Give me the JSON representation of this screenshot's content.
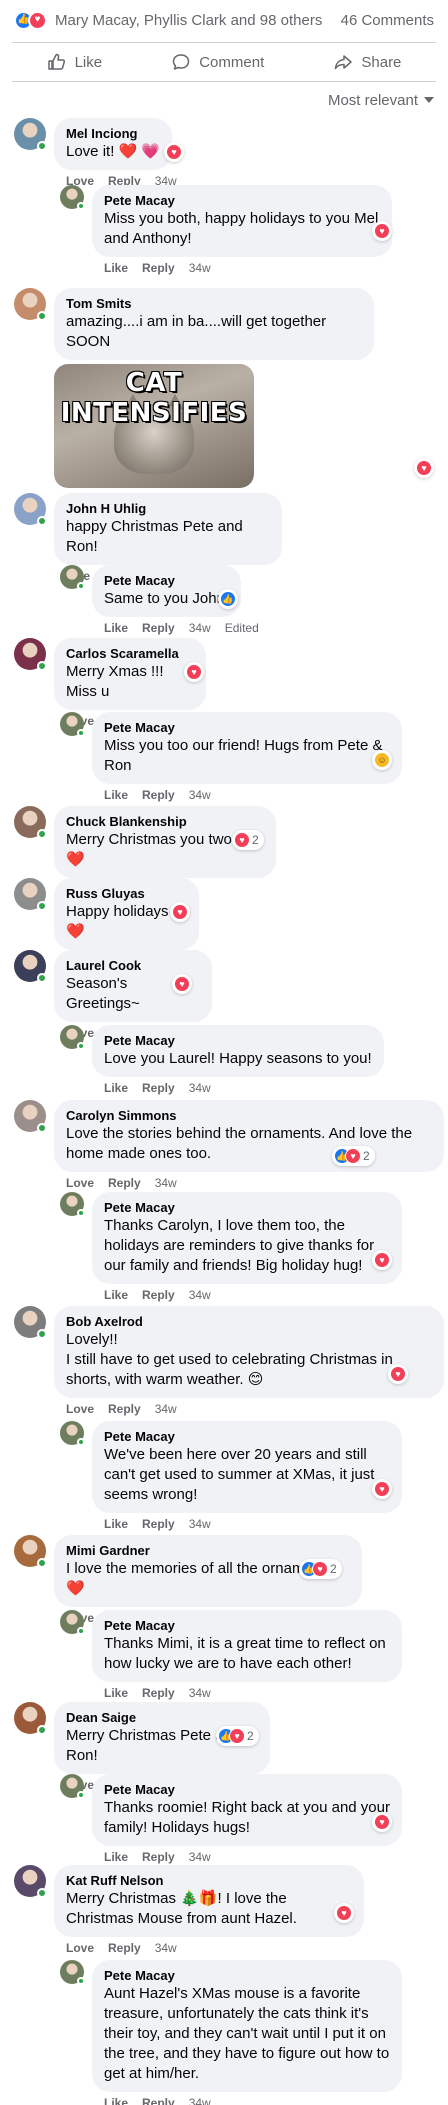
{
  "summary": {
    "names": "Mary Macay, Phyllis Clark and 98 others",
    "comments": "46 Comments",
    "like_glyph": "👍",
    "love_glyph": "♥"
  },
  "actions": {
    "like": "Like",
    "comment": "Comment",
    "share": "Share"
  },
  "sort": {
    "label": "Most relevant"
  },
  "meta_labels": {
    "love": "Love",
    "like": "Like",
    "reply": "Reply",
    "edited": "Edited"
  },
  "colors": {
    "like": "#1877f2",
    "love": "#f33e58",
    "bubble": "#f0f2f5",
    "meta": "#65676b"
  },
  "comments": [
    {
      "author": "Mel Inciong",
      "text": "Love it! ❤️ 💗",
      "time": "34w",
      "reaction": "love"
    },
    {
      "author": "Pete Macay",
      "text": "Miss you both, happy holidays to you Mel and Anthony!",
      "time": "34w",
      "reaction": "love"
    },
    {
      "author": "Tom Smits",
      "text": "amazing....i am in ba....will get together SOON",
      "time": "34w",
      "reaction": "love",
      "gif_text": "CAT INTENSIFIES"
    },
    {
      "author": "John H Uhlig",
      "text": "happy Christmas Pete and Ron!",
      "time": "34w"
    },
    {
      "author": "Pete Macay",
      "text": "Same to you John!",
      "time": "34w",
      "edited": "Edited",
      "reaction": "like"
    },
    {
      "author": "Carlos Scaramella",
      "text": "Merry Xmas !!! Miss u",
      "time": "34w",
      "reaction": "love"
    },
    {
      "author": "Pete Macay",
      "text": "Miss you too our friend! Hugs from Pete & Ron",
      "time": "34w",
      "reaction": "care"
    },
    {
      "author": "Chuck Blankenship",
      "text": "Merry Christmas you two ❤️ ❤️",
      "time": "34w",
      "reaction": "love",
      "reaction_count": "2"
    },
    {
      "author": "Russ Gluyas",
      "text": "Happy holidays ❤️",
      "time": "34w",
      "reaction": "love"
    },
    {
      "author": "Laurel Cook",
      "text": "Season's Greetings~",
      "time": "34w",
      "reaction": "love"
    },
    {
      "author": "Pete Macay",
      "text": "Love you Laurel! Happy seasons to you!",
      "time": "34w"
    },
    {
      "author": "Carolyn Simmons",
      "text": "Love the stories behind the ornaments. And love the home made ones too.",
      "time": "34w",
      "reaction": "like-love",
      "reaction_count": "2"
    },
    {
      "author": "Pete Macay",
      "text": "Thanks Carolyn, I love them too, the holidays are reminders to give thanks for our family and friends! Big holiday hug!",
      "time": "34w",
      "reaction": "love"
    },
    {
      "author": "Bob Axelrod",
      "text": "Lovely!!\nI still have to get used to celebrating Christmas in shorts, with warm weather. 😊",
      "time": "34w",
      "reaction": "love"
    },
    {
      "author": "Pete Macay",
      "text": "We've been here over 20 years and still can't get used to summer at XMas, it just seems wrong!",
      "time": "34w",
      "reaction": "love"
    },
    {
      "author": "Mimi Gardner",
      "text": "I love the memories of all the ornaments. ❤️",
      "time": "34w",
      "reaction": "like-love",
      "reaction_count": "2"
    },
    {
      "author": "Pete Macay",
      "text": "Thanks Mimi, it is a great time to reflect on how lucky we are to have each other!",
      "time": "34w"
    },
    {
      "author": "Dean Saige",
      "text": "Merry Christmas Pete and Ron!",
      "time": "34w",
      "reaction": "like-love",
      "reaction_count": "2"
    },
    {
      "author": "Pete Macay",
      "text": "Thanks roomie! Right back at you and your family! Holidays hugs!",
      "time": "34w",
      "reaction": "love"
    },
    {
      "author": "Kat Ruff Nelson",
      "text": "Merry Christmas 🎄🎁! I love the Christmas Mouse from aunt Hazel.",
      "time": "34w",
      "reaction": "love"
    },
    {
      "author": "Pete Macay",
      "text": "Aunt Hazel's XMas mouse is a favorite treasure, unfortunately the cats think it's their toy, and they can't wait until I put it on the tree, and they have to figure out how to get at him/her.",
      "time": "34w"
    }
  ]
}
